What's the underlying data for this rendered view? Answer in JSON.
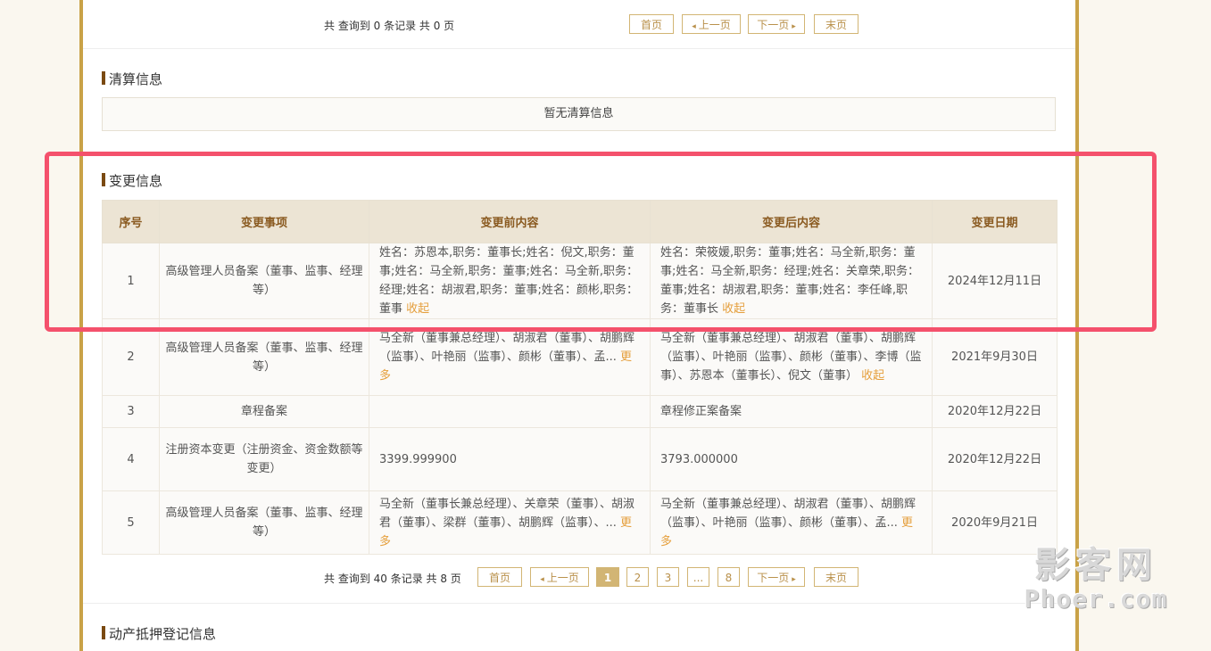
{
  "top_pager": {
    "count": "共 查询到 0 条记录 共 0 页",
    "first": "首页",
    "prev": "上一页",
    "next": "下一页",
    "last": "末页"
  },
  "liquidation": {
    "title": "清算信息",
    "empty": "暂无清算信息"
  },
  "changes": {
    "title": "变更信息",
    "headers": {
      "no": "序号",
      "item": "变更事项",
      "before": "变更前内容",
      "after": "变更后内容",
      "date": "变更日期"
    },
    "rows": [
      {
        "no": "1",
        "item": "高级管理人员备案（董事、监事、经理等）",
        "before": "姓名：苏恩本,职务：董事长;姓名：倪文,职务：董事;姓名：马全新,职务：董事;姓名：马全新,职务：经理;姓名：胡淑君,职务：董事;姓名：颜彬,职务：董事",
        "before_toggle": "收起",
        "after": "姓名：荣筱媛,职务：董事;姓名：马全新,职务：董事;姓名：马全新,职务：经理;姓名：关章荣,职务：董事;姓名：胡淑君,职务：董事;姓名：李任峰,职务：董事长",
        "after_toggle": "收起",
        "date": "2024年12月11日"
      },
      {
        "no": "2",
        "item": "高级管理人员备案（董事、监事、经理等）",
        "before": "马全新（董事兼总经理）、胡淑君（董事）、胡鹏辉（监事）、叶艳丽（监事）、颜彬（董事）、孟...",
        "before_toggle": "更多",
        "after": "马全新（董事兼总经理）、胡淑君（董事）、胡鹏辉（监事）、叶艳丽（监事）、颜彬（董事）、李博（监事）、苏恩本（董事长）、倪文（董事）",
        "after_toggle": "收起",
        "date": "2021年9月30日"
      },
      {
        "no": "3",
        "item": "章程备案",
        "before": "",
        "before_toggle": "",
        "after": "章程修正案备案",
        "after_toggle": "",
        "date": "2020年12月22日"
      },
      {
        "no": "4",
        "item": "注册资本变更（注册资金、资金数额等变更）",
        "before": "3399.999900",
        "before_toggle": "",
        "after": "3793.000000",
        "after_toggle": "",
        "date": "2020年12月22日"
      },
      {
        "no": "5",
        "item": "高级管理人员备案（董事、监事、经理等）",
        "before": "马全新（董事长兼总经理）、关章荣（董事）、胡淑君（董事）、梁群（董事）、胡鹏辉（监事）、...",
        "before_toggle": "更多",
        "after": "马全新（董事兼总经理）、胡淑君（董事）、胡鹏辉（监事）、叶艳丽（监事）、颜彬（董事）、孟...",
        "after_toggle": "更多",
        "date": "2020年9月21日"
      }
    ]
  },
  "bottom_pager": {
    "count": "共 查询到 40 条记录 共 8 页",
    "first": "首页",
    "prev": "上一页",
    "pages": [
      "1",
      "2",
      "3",
      "...",
      "8"
    ],
    "next": "下一页",
    "last": "末页"
  },
  "pledge": {
    "title": "动产抵押登记信息"
  },
  "watermark": {
    "cn": "影客网",
    "en": "Phoer.com"
  },
  "colors": {
    "accent": "#c9a247",
    "highlight": "#f4516c",
    "link": "#e59f3c"
  }
}
